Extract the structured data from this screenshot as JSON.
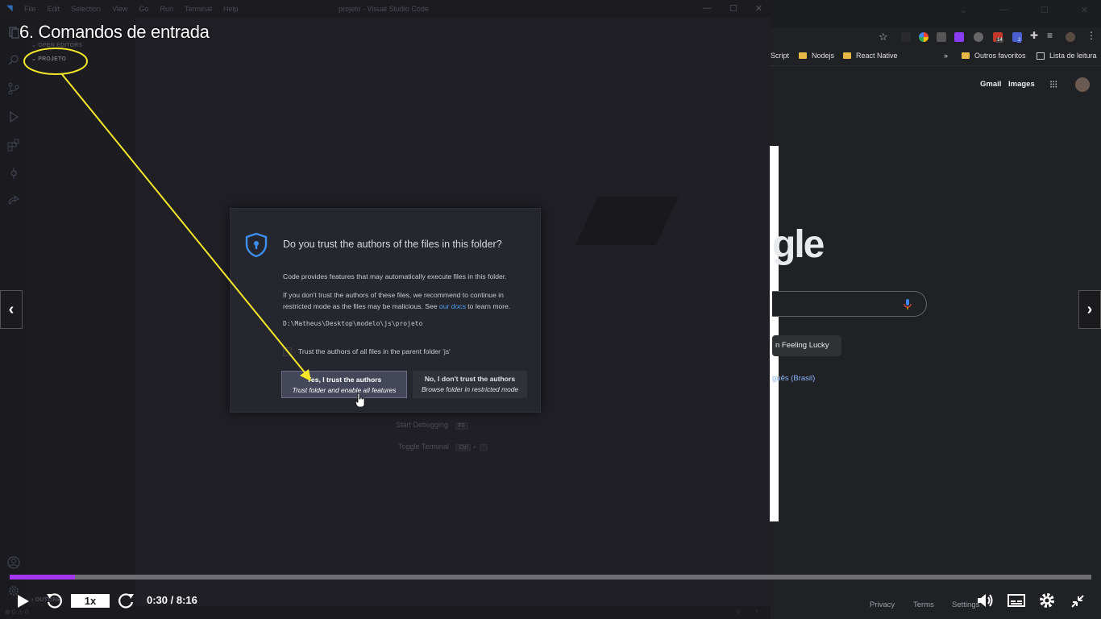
{
  "lesson_title": "6. Comandos de entrada",
  "vscode": {
    "menu": [
      "File",
      "Edit",
      "Selection",
      "View",
      "Go",
      "Run",
      "Terminal",
      "Help"
    ],
    "window_title": "projeto - Visual Studio Code",
    "sidebar": {
      "open_editors": "OPEN EDITORS",
      "folder_name": "PROJETO",
      "outline": "OUTLINE"
    },
    "shortcuts": [
      {
        "label": "Start Debugging",
        "keys": [
          "F5"
        ]
      },
      {
        "label": "Toggle Terminal",
        "keys": [
          "Ctrl",
          "+",
          "'"
        ]
      }
    ],
    "status_left": "⊗ 0 ⚠ 0"
  },
  "dialog": {
    "title": "Do you trust the authors of the files in this folder?",
    "paragraph1": "Code provides features that may automatically execute files in this folder.",
    "paragraph2_part1": "If you don't trust the authors of these files, we recommend to continue in restricted mode as the files may be malicious. See ",
    "paragraph2_link": "our docs",
    "paragraph2_part2": " to learn more.",
    "path": "D:\\Matheus\\Desktop\\modelo\\js\\projeto",
    "checkbox_label": "Trust the authors of all files in the parent folder 'js'",
    "yes_button": {
      "label": "Yes, I trust the authors",
      "sub": "Trust folder and enable all features"
    },
    "no_button": {
      "label": "No, I don't trust the authors",
      "sub": "Browse folder in restricted mode"
    }
  },
  "browser": {
    "bookmarks": [
      "Script",
      "Nodejs",
      "React Native",
      "Outros favoritos",
      "Lista de leitura"
    ],
    "bookmarks_more": "»",
    "google_links": [
      "Gmail",
      "Images"
    ],
    "logo_partial": "gle",
    "lucky_button": "n Feeling Lucky",
    "language_link": "guês (Brasil)",
    "footer": [
      "Privacy",
      "Terms",
      "Settings"
    ],
    "badges": [
      "14",
      "2"
    ]
  },
  "player": {
    "speed": "1x",
    "time_current": "0:30",
    "time_separator": " / ",
    "time_total": "8:16",
    "progress_fraction": 0.0605,
    "accent_color": "#a435f0"
  }
}
